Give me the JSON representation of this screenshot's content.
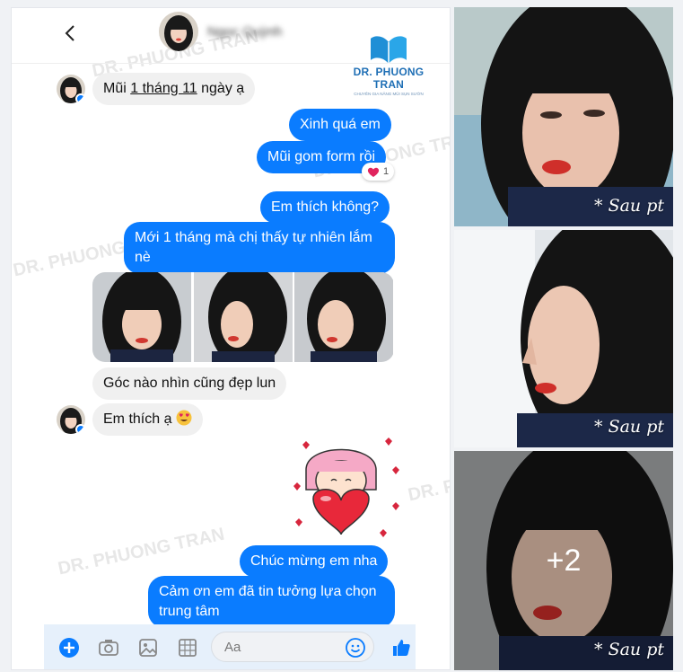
{
  "colors": {
    "messenger_blue": "#0a7cff",
    "incoming_bg": "#f0f0f0",
    "brand_blue": "#1f6fb5"
  },
  "header": {
    "back_icon": "chevron-left-icon",
    "contact_name": "Ngọc Quỳnh"
  },
  "brand": {
    "name": "DR. PHUONG TRAN",
    "tagline": "CHUYÊN GIA NÂNG MŨI SỤN SƯỜN"
  },
  "watermark": "DR. PHUONG TRAN",
  "messages": [
    {
      "dir": "in",
      "before": "Mũi ",
      "link": "1 tháng 11",
      "after": " ngày ạ"
    },
    {
      "dir": "out",
      "text": "Xinh quá em"
    },
    {
      "dir": "out",
      "text": "Mũi gom form rồi"
    },
    {
      "dir": "out",
      "text": "Em thích không?"
    },
    {
      "dir": "out",
      "line1": "Mới 1 tháng mà chị thấy tự nhiên lắm",
      "line2": "nè"
    },
    {
      "dir": "in",
      "text": "Góc nào nhìn cũng đẹp lun"
    },
    {
      "dir": "in",
      "text": "Em thích ạ"
    },
    {
      "dir": "out",
      "text": "Chúc mừng em nha"
    },
    {
      "dir": "out",
      "line1": "Cảm ơn em đã tin tưởng lựa chọn",
      "line2": "trung tâm"
    }
  ],
  "reaction": {
    "emoji": "heart",
    "count": "1"
  },
  "composer": {
    "placeholder": "Aa",
    "icons": [
      "plus-icon",
      "camera-icon",
      "image-icon",
      "gif-icon",
      "emoji-icon",
      "like-icon"
    ]
  },
  "right_photos": [
    {
      "caption": "* Sau pt"
    },
    {
      "caption": "* Sau pt"
    },
    {
      "caption": "* Sau pt",
      "more": "+2"
    }
  ]
}
